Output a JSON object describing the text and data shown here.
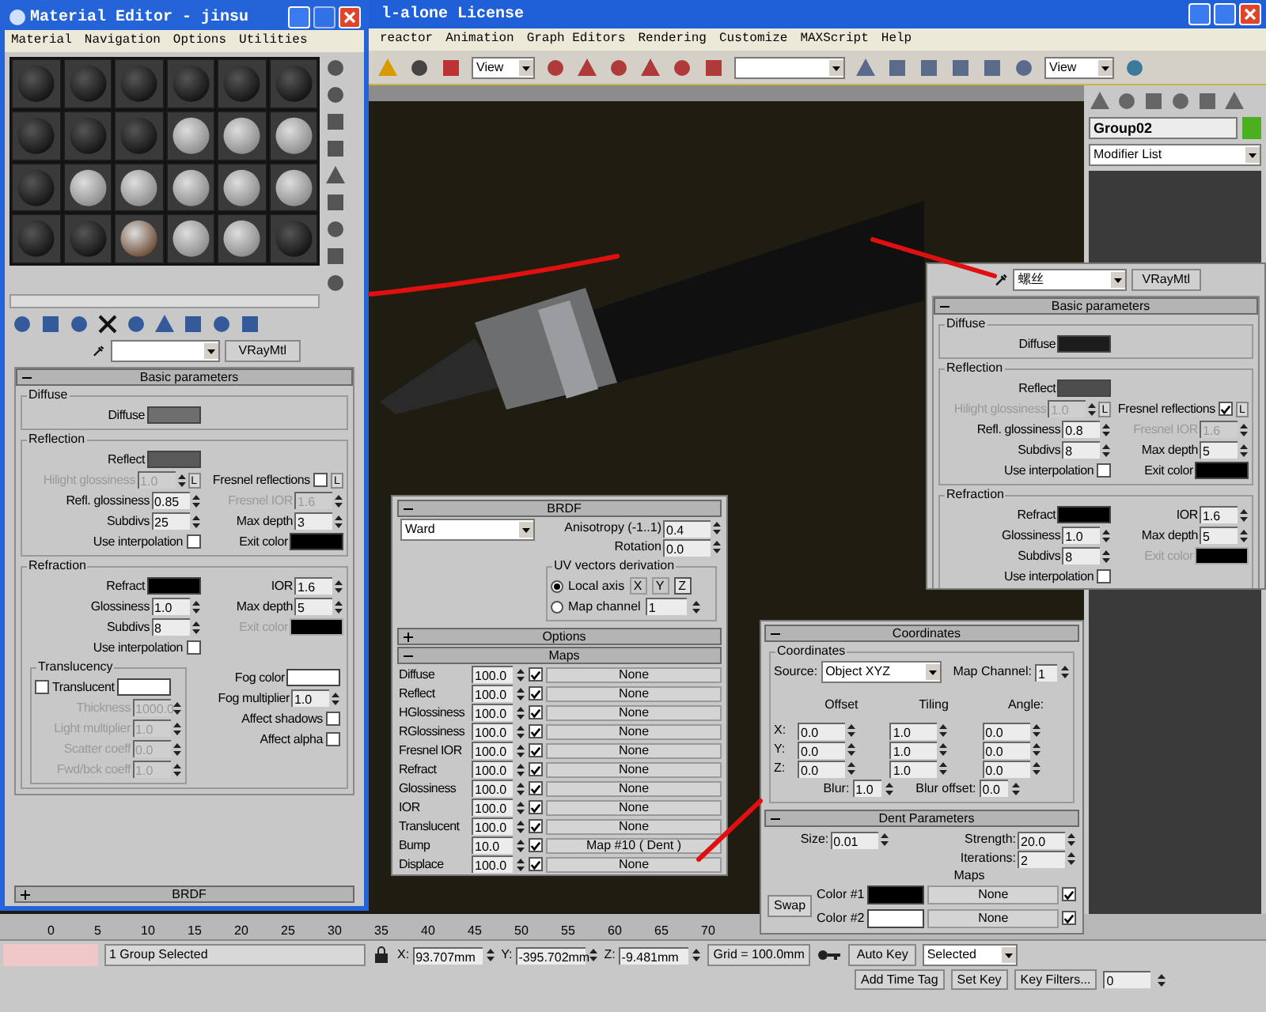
{
  "main_window": {
    "title": "l-alone License",
    "menu": [
      "reactor",
      "Animation",
      "Graph Editors",
      "Rendering",
      "Customize",
      "MAXScript",
      "Help"
    ],
    "view_dropdowns": [
      "View",
      "View"
    ],
    "command_panel": {
      "object_name": "Group02",
      "modifier_list": "Modifier List"
    }
  },
  "material_editor": {
    "title": "Material Editor - jinsu",
    "menu": [
      "Material",
      "Navigation",
      "Options",
      "Utilities"
    ],
    "material_type": "VRayMtl",
    "rollout": {
      "title": "Basic parameters",
      "expanded": true,
      "groups": [
        {
          "title": "Diffuse",
          "rows": [
            [
              {
                "kind": "swatch",
                "label": "Diffuse",
                "color": "#6e6e6e",
                "disabled": false
              }
            ]
          ]
        },
        {
          "title": "Reflection",
          "rows": [
            [
              {
                "kind": "swatch",
                "label": "Reflect",
                "color": "#595959",
                "disabled": false
              }
            ],
            [
              {
                "kind": "spinner",
                "label": "Hilight glossiness",
                "value": "1.0",
                "disabled": true,
                "lock": "L"
              },
              {
                "kind": "checkbox",
                "label": "Fresnel reflections",
                "checked": false,
                "disabled": false,
                "lock": "L"
              }
            ],
            [
              {
                "kind": "spinner",
                "label": "Refl. glossiness",
                "value": "0.85",
                "disabled": false
              },
              {
                "kind": "spinner",
                "label": "Fresnel IOR",
                "value": "1.6",
                "disabled": true
              }
            ],
            [
              {
                "kind": "spinner",
                "label": "Subdivs",
                "value": "25",
                "disabled": false
              },
              {
                "kind": "spinner",
                "label": "Max depth",
                "value": "3",
                "disabled": false
              }
            ],
            [
              {
                "kind": "checkbox",
                "label": "Use interpolation",
                "checked": false,
                "disabled": false
              },
              {
                "kind": "swatch",
                "label": "Exit color",
                "color": "#000000",
                "disabled": false
              }
            ]
          ]
        },
        {
          "title": "Refraction",
          "rows": [
            [
              {
                "kind": "swatch",
                "label": "Refract",
                "color": "#000000",
                "disabled": false
              },
              {
                "kind": "spinner",
                "label": "IOR",
                "value": "1.6",
                "disabled": false
              }
            ],
            [
              {
                "kind": "spinner",
                "label": "Glossiness",
                "value": "1.0",
                "disabled": false
              },
              {
                "kind": "spinner",
                "label": "Max depth",
                "value": "5",
                "disabled": false
              }
            ],
            [
              {
                "kind": "spinner",
                "label": "Subdivs",
                "value": "8",
                "disabled": false
              },
              {
                "kind": "swatch",
                "label": "Exit color",
                "color": "#000000",
                "disabled": true
              }
            ],
            [
              {
                "kind": "checkbox",
                "label": "Use interpolation",
                "checked": false,
                "disabled": false
              }
            ]
          ],
          "subgroup": {
            "title": "Translucency",
            "items": [
              {
                "kind": "check_swatch",
                "label": "Translucent",
                "checked": false,
                "color": "#ffffff",
                "disabled": false
              },
              {
                "kind": "spinner",
                "label": "Thickness",
                "value": "1000.0",
                "disabled": true
              },
              {
                "kind": "spinner",
                "label": "Light multiplier",
                "value": "1.0",
                "disabled": true
              },
              {
                "kind": "spinner",
                "label": "Scatter coeff",
                "value": "0.0",
                "disabled": true
              },
              {
                "kind": "spinner",
                "label": "Fwd/bck coeff",
                "value": "1.0",
                "disabled": true
              }
            ],
            "side": [
              {
                "kind": "swatch",
                "label": "Fog color",
                "color": "#ffffff",
                "disabled": false
              },
              {
                "kind": "spinner",
                "label": "Fog multiplier",
                "value": "1.0",
                "disabled": false
              },
              {
                "kind": "checkbox",
                "label": "Affect shadows",
                "checked": false,
                "disabled": false
              },
              {
                "kind": "checkbox",
                "label": "Affect alpha",
                "checked": false,
                "disabled": false
              }
            ]
          }
        }
      ]
    },
    "next_rollout": {
      "title": "BRDF",
      "expanded": false
    }
  },
  "material_panel": {
    "name": "螺丝",
    "material_type": "VRayMtl",
    "rollout": {
      "title": "Basic parameters",
      "expanded": true,
      "groups": [
        {
          "title": "Diffuse",
          "rows": [
            [
              {
                "kind": "swatch",
                "label": "Diffuse",
                "color": "#1c1c1c",
                "disabled": false
              }
            ]
          ]
        },
        {
          "title": "Reflection",
          "rows": [
            [
              {
                "kind": "swatch",
                "label": "Reflect",
                "color": "#4d4d4d",
                "disabled": false
              }
            ],
            [
              {
                "kind": "spinner",
                "label": "Hilight glossiness",
                "value": "1.0",
                "disabled": true,
                "lock": "L"
              },
              {
                "kind": "checkbox",
                "label": "Fresnel reflections",
                "checked": true,
                "disabled": false,
                "lock": "L"
              }
            ],
            [
              {
                "kind": "spinner",
                "label": "Refl. glossiness",
                "value": "0.8",
                "disabled": false
              },
              {
                "kind": "spinner",
                "label": "Fresnel IOR",
                "value": "1.6",
                "disabled": true
              }
            ],
            [
              {
                "kind": "spinner",
                "label": "Subdivs",
                "value": "8",
                "disabled": false
              },
              {
                "kind": "spinner",
                "label": "Max depth",
                "value": "5",
                "disabled": false
              }
            ],
            [
              {
                "kind": "checkbox",
                "label": "Use interpolation",
                "checked": false,
                "disabled": false
              },
              {
                "kind": "swatch",
                "label": "Exit color",
                "color": "#000000",
                "disabled": false
              }
            ]
          ]
        },
        {
          "title": "Refraction",
          "rows": [
            [
              {
                "kind": "swatch",
                "label": "Refract",
                "color": "#000000",
                "disabled": false
              },
              {
                "kind": "spinner",
                "label": "IOR",
                "value": "1.6",
                "disabled": false
              }
            ],
            [
              {
                "kind": "spinner",
                "label": "Glossiness",
                "value": "1.0",
                "disabled": false
              },
              {
                "kind": "spinner",
                "label": "Max depth",
                "value": "5",
                "disabled": false
              }
            ],
            [
              {
                "kind": "spinner",
                "label": "Subdivs",
                "value": "8",
                "disabled": false
              },
              {
                "kind": "swatch",
                "label": "Exit color",
                "color": "#000000",
                "disabled": true
              }
            ],
            [
              {
                "kind": "checkbox",
                "label": "Use interpolation",
                "checked": false,
                "disabled": false
              }
            ]
          ]
        }
      ]
    }
  },
  "brdf_panel": {
    "rollout": {
      "title": "BRDF",
      "expanded": true
    },
    "type": "Ward",
    "anisotropy": {
      "label": "Anisotropy (-1..1)",
      "value": "0.4"
    },
    "rotation": {
      "label": "Rotation",
      "value": "0.0"
    },
    "uv_group": {
      "title": "UV vectors derivation",
      "options": [
        {
          "label": "Local axis",
          "selected": true
        },
        {
          "label": "Map channel",
          "selected": false
        }
      ],
      "axes": [
        {
          "label": "X",
          "selected": false
        },
        {
          "label": "Y",
          "selected": false
        },
        {
          "label": "Z",
          "selected": true
        }
      ],
      "map_channel": "1"
    },
    "options_rollout": {
      "title": "Options",
      "expanded": false
    },
    "maps_rollout": {
      "title": "Maps",
      "expanded": true
    },
    "maps": [
      {
        "name": "Diffuse",
        "amount": "100.0",
        "checked": true,
        "map": "None"
      },
      {
        "name": "Reflect",
        "amount": "100.0",
        "checked": true,
        "map": "None"
      },
      {
        "name": "HGlossiness",
        "amount": "100.0",
        "checked": true,
        "map": "None"
      },
      {
        "name": "RGlossiness",
        "amount": "100.0",
        "checked": true,
        "map": "None"
      },
      {
        "name": "Fresnel IOR",
        "amount": "100.0",
        "checked": true,
        "map": "None"
      },
      {
        "name": "Refract",
        "amount": "100.0",
        "checked": true,
        "map": "None"
      },
      {
        "name": "Glossiness",
        "amount": "100.0",
        "checked": true,
        "map": "None"
      },
      {
        "name": "IOR",
        "amount": "100.0",
        "checked": true,
        "map": "None"
      },
      {
        "name": "Translucent",
        "amount": "100.0",
        "checked": true,
        "map": "None"
      },
      {
        "name": "Bump",
        "amount": "10.0",
        "checked": true,
        "map": "Map #10 ( Dent )"
      },
      {
        "name": "Displace",
        "amount": "100.0",
        "checked": true,
        "map": "None"
      }
    ]
  },
  "dent_panel": {
    "coordinates_rollout": {
      "title": "Coordinates",
      "expanded": true
    },
    "group_title": "Coordinates",
    "source_label": "Source:",
    "source": "Object XYZ",
    "map_channel_label": "Map Channel:",
    "map_channel": "1",
    "columns": [
      "Offset",
      "Tiling",
      "Angle:"
    ],
    "axes": [
      {
        "label": "X:",
        "values": [
          "0.0",
          "1.0",
          "0.0"
        ]
      },
      {
        "label": "Y:",
        "values": [
          "0.0",
          "1.0",
          "0.0"
        ]
      },
      {
        "label": "Z:",
        "values": [
          "0.0",
          "1.0",
          "0.0"
        ]
      }
    ],
    "blur": {
      "label": "Blur:",
      "value": "1.0"
    },
    "blur_offset": {
      "label": "Blur offset:",
      "value": "0.0"
    },
    "dent_rollout": {
      "title": "Dent Parameters",
      "expanded": true
    },
    "size": {
      "label": "Size:",
      "value": "0.01"
    },
    "strength": {
      "label": "Strength:",
      "value": "20.0"
    },
    "iterations": {
      "label": "Iterations:",
      "value": "2"
    },
    "maps_label": "Maps",
    "swap": "Swap",
    "colors": [
      {
        "label": "Color #1",
        "color": "#000000",
        "map": "None",
        "checked": true
      },
      {
        "label": "Color #2",
        "color": "#ffffff",
        "map": "None",
        "checked": true
      }
    ]
  },
  "timeline": {
    "ticks": [
      "0",
      "5",
      "10",
      "15",
      "20",
      "25",
      "30",
      "35",
      "40",
      "45",
      "50",
      "55",
      "60",
      "65",
      "70"
    ]
  },
  "status_bar": {
    "selection": "1 Group Selected",
    "coords": [
      {
        "label": "X:",
        "value": "93.707mm"
      },
      {
        "label": "Y:",
        "value": "-395.702mm"
      },
      {
        "label": "Z:",
        "value": "-9.481mm"
      }
    ],
    "grid": "Grid = 100.0mm",
    "auto_key": "Auto Key",
    "key_mode": "Selected",
    "add_time_tag": "Add Time Tag",
    "set_key": "Set Key",
    "key_filters": "Key Filters...",
    "frame": "0"
  }
}
